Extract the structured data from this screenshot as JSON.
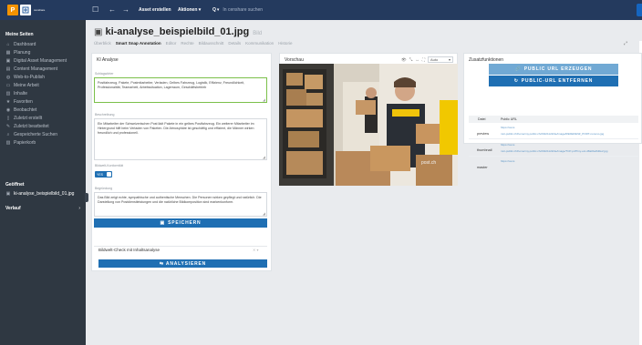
{
  "app": {
    "logo_letters": "P",
    "logo_sub": "censhare"
  },
  "topbar": {
    "create_label": "Asset erstellen",
    "actions_label": "Aktionen",
    "search_prefix": "Q",
    "search_placeholder": "In censhare suchen"
  },
  "sidebar": {
    "heading_pages": "Meine Seiten",
    "items": [
      {
        "label": "Dashboard",
        "icon": "home-icon"
      },
      {
        "label": "Planung",
        "icon": "calendar-icon"
      },
      {
        "label": "Digital Asset Management",
        "icon": "image-icon"
      },
      {
        "label": "Content Management",
        "icon": "doc-icon"
      },
      {
        "label": "Web-to-Publish",
        "icon": "globe-icon"
      },
      {
        "label": "Meine Arbeit",
        "icon": "inbox-icon"
      },
      {
        "label": "Inhalte",
        "icon": "folder-icon"
      },
      {
        "label": "Favoriten",
        "icon": "star-icon"
      },
      {
        "label": "Beobachtet",
        "icon": "eye-icon"
      },
      {
        "label": "Zuletzt erstellt",
        "icon": "file-icon"
      },
      {
        "label": "Zuletzt bearbeitet",
        "icon": "edit-icon"
      },
      {
        "label": "Gespeicherte Suchen",
        "icon": "search-icon"
      },
      {
        "label": "Papierkorb",
        "icon": "trash-icon"
      }
    ],
    "heading_open": "Geöffnet",
    "open_item": "ki-analyse_beispielbild_01.jpg",
    "heading_history": "Verlauf"
  },
  "page": {
    "title": "ki-analyse_beispielbild_01.jpg",
    "subtitle": "Bild",
    "tabs": [
      "Überblick",
      "Smart Snap Annotation",
      "Editor",
      "Rechte",
      "Bildausschnitt",
      "Details",
      "Kommunikation",
      "Historie"
    ],
    "active_tab": "Smart Snap Annotation"
  },
  "ki_panel": {
    "title": "KI Analyse",
    "keywords_label": "Schlagwörter",
    "keywords_value": "Postfahrzeug, Pakete, Postmitarbeiter, Verladen, Gelbes Fahrzeug, Logistik, Effizienz, Freundlichkeit, Professionalität, Teamarbeit, Arbeitssituation, Lagerraum, Geschäftsbetrieb",
    "description_label": "Beschreibung",
    "description_value": "Ein Mitarbeiter der Schweizerischen Post lädt Pakete in ein gelbes Postfahrzeug. Ein weiterer Mitarbeiter im Hintergrund hilft beim Verladen von Paketen. Die Atmosphäre ist geschäftig und effizient, die Männer wirken freundlich und professionell.",
    "conformity_label": "Bildwelt-Konformität",
    "conformity_toggle": "YES",
    "reason_label": "Begründung",
    "reason_value": "Das Bild zeigt echte, sympathische und authentische Menschen. Die Personen wirken gepflegt und natürlich. Die Darstellung von Postdienstleistungen und die natürliche Bildkomposition sind markenkonform.",
    "save_button": "SPEICHERN",
    "check_label": "Bildwelt-Check mit Inhaltsanalyse",
    "analyze_button": "ANALYSIEREN"
  },
  "preview_panel": {
    "title": "Vorschau",
    "zoom_value": "Auto",
    "watermark": "post.ch"
  },
  "extra_panel": {
    "title": "Zusatzfunktionen",
    "create_url_button": "PUBLIC URL ERZEUGEN",
    "remove_url_button": "PUBLIC-URL ENTFERNEN",
    "table_headers": [
      "Datei",
      "Public URL"
    ],
    "rows": [
      {
        "name": "preview",
        "urls": [
          "https://cens",
          "mnt-public.ch/home/my.public.ch/20221122/de/image/REFERENZ_PORT-nonono.jpg"
        ]
      },
      {
        "name": "thumbnail",
        "urls": [
          "https://cens",
          "mnt-public.ch/home/my.public.ch/20221122/de/image/TCP-pdf?my-etc-d8a0be8d0e2.jpg"
        ]
      },
      {
        "name": "master",
        "urls": [
          "https://cens"
        ]
      }
    ]
  },
  "colors": {
    "topbar": "#243a5e",
    "sidebar": "#2f3842",
    "accent": "#1f6fb3",
    "highlight": "#7bc04a"
  }
}
